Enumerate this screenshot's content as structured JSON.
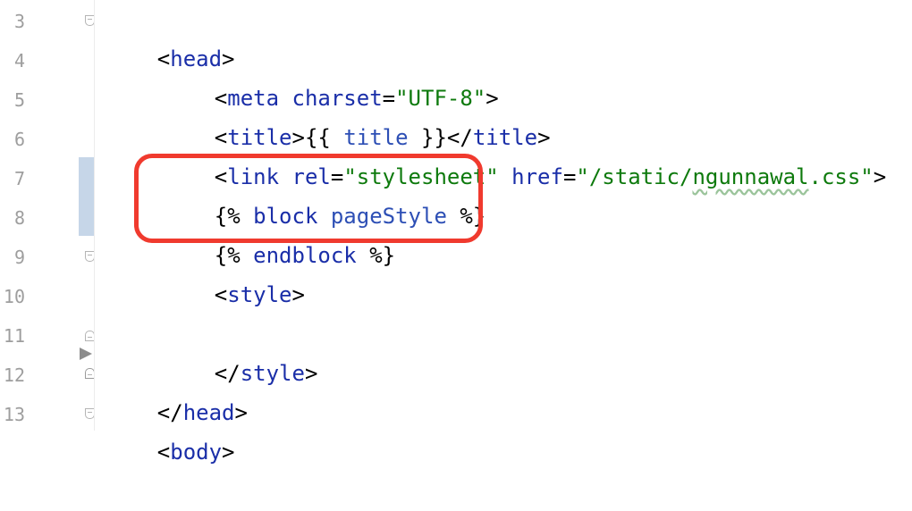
{
  "gutter": {
    "line_numbers": [
      "3",
      "4",
      "5",
      "6",
      "7",
      "8",
      "9",
      "10",
      "11",
      "12",
      "13"
    ]
  },
  "code": {
    "line3": {
      "open": "<",
      "tag": "head",
      "close": ">"
    },
    "line4": {
      "open": "<",
      "tag": "meta",
      "attr": "charset",
      "eq": "=",
      "value": "\"UTF-8\"",
      "close": ">"
    },
    "line5": {
      "open": "<",
      "tag": "title",
      "close": ">",
      "tpl_open": "{{",
      "variable": "title",
      "tpl_close": "}}",
      "end_open": "</",
      "end_tag": "title",
      "end_close": ">"
    },
    "line6": {
      "open": "<",
      "tag": "link",
      "attr1": "rel",
      "eq1": "=",
      "value1": "\"stylesheet\"",
      "attr2": "href",
      "eq2": "=",
      "value2_prefix": "\"/static/",
      "value2_typo": "ngunnawal",
      "value2_suffix": ".css\"",
      "close": ">"
    },
    "line7": {
      "open": "{%",
      "keyword": "block",
      "name": "pageStyle",
      "close": "%}"
    },
    "line8": {
      "open": "{%",
      "keyword": "endblock",
      "close": "%}"
    },
    "line9": {
      "open": "<",
      "tag": "style",
      "close": ">"
    },
    "line10": {
      "text": ""
    },
    "line11": {
      "open": "</",
      "tag": "style",
      "close": ">"
    },
    "line12": {
      "open": "</",
      "tag": "head",
      "close": ">"
    },
    "line13": {
      "open": "<",
      "tag": "body",
      "close": ">"
    }
  },
  "colors": {
    "tag": "#1a2ea8",
    "string": "#0e7a0d",
    "template": "#2d4fb5",
    "highlight": "#f03a2e",
    "change_marker": "#c6d6e8"
  }
}
